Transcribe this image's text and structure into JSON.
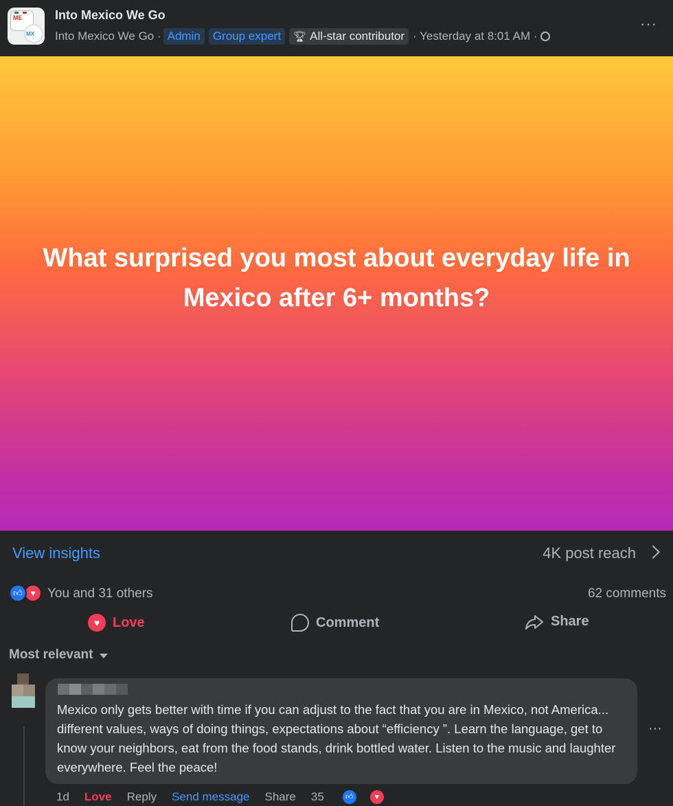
{
  "post": {
    "group_name": "Into Mexico We Go",
    "author": "Into Mexico We Go ·",
    "badges": [
      "Admin",
      "Group expert"
    ],
    "contributor_badge": "All-star contributor",
    "timestamp": "· Yesterday at 8:01 AM ·",
    "more_label": "···",
    "banner_text": "What surprised you most about everyday life in Mexico after 6+ months?"
  },
  "insights": {
    "view_label": "View insights",
    "reach": "4K post reach"
  },
  "reactions": {
    "summary": "You and 31 others",
    "comments": "62 comments"
  },
  "actions": {
    "love": "Love",
    "comment": "Comment",
    "share": "Share"
  },
  "comments_section": {
    "sort_label": "Most relevant"
  },
  "comment": {
    "text": "Mexico only gets better with time if you can adjust to the fact that you are in Mexico, not America... different values, ways of doing things, expectations about “efficiency ”. Learn the language, get to know your neighbors, eat from the food stands, drink bottled water. Listen to the music and laughter everywhere. Feel the peace!",
    "time": "1d",
    "love": "Love",
    "reply": "Reply",
    "send_message": "Send message",
    "share": "Share",
    "reaction_count": "35",
    "more_label": "···"
  },
  "colors": {
    "background": "#242526",
    "accent_blue": "#4599ff",
    "love_red": "#f33e58",
    "like_blue": "#2078f4"
  }
}
